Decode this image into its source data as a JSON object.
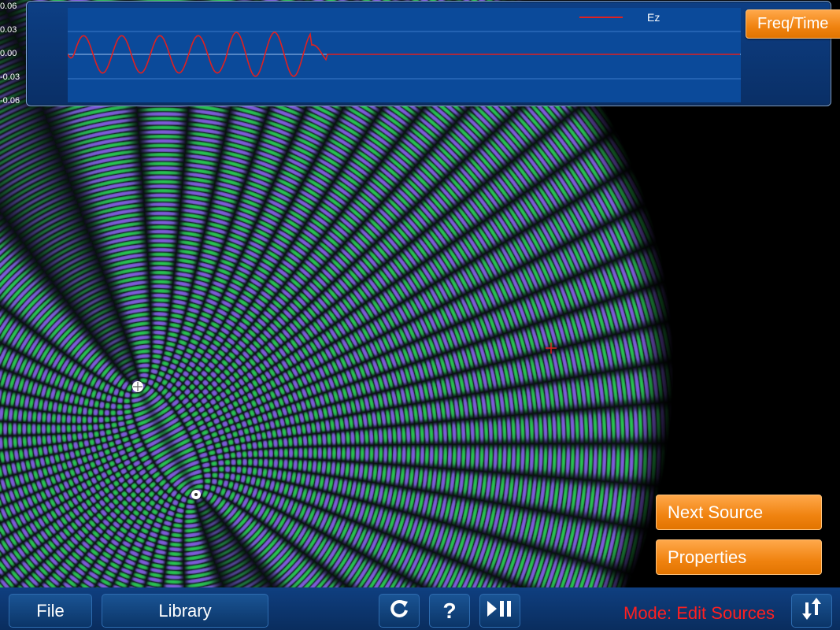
{
  "probe": {
    "yticks": [
      "0.06",
      "0.03",
      "0.00",
      "-0.03",
      "-0.06"
    ],
    "legend": "Ez",
    "freq_time_label": "Freq/Time"
  },
  "buttons": {
    "next_source": "Next Source",
    "properties": "Properties"
  },
  "toolbar": {
    "file": "File",
    "library": "Library",
    "help": "?",
    "mode": "Mode: Edit Sources"
  },
  "icons": {
    "refresh": "refresh-icon",
    "help": "help-icon",
    "play_pause": "play-pause-icon",
    "swap": "swap-arrows-icon"
  },
  "colors": {
    "accent_orange": "#f08310",
    "mode_red": "#ff2020",
    "wave_green": "#2f8a50",
    "wave_blue": "#6c6fcc",
    "probe_line": "#e02020"
  }
}
